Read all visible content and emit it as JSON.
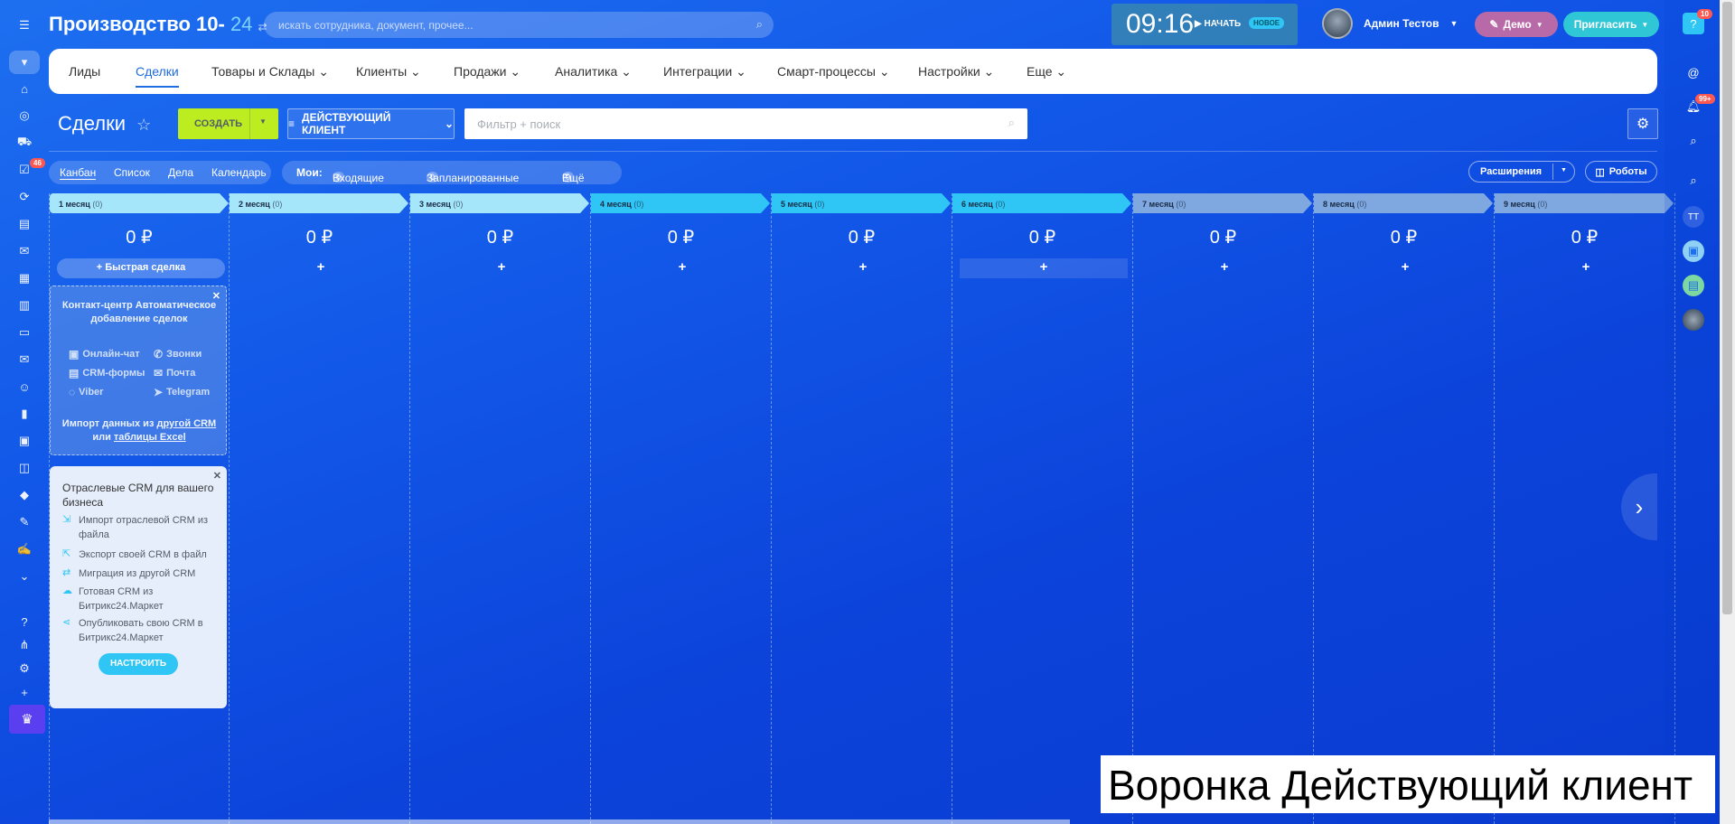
{
  "header": {
    "portal_name": "Производство 10-",
    "portal_suffix": "24",
    "search_placeholder": "искать сотрудника, документ, прочее...",
    "time": "09:16",
    "start_label": "НАЧАТЬ",
    "new_badge": "НОВОЕ",
    "user_name": "Админ Тестов",
    "demo_label": "Демо",
    "invite_label": "Пригласить",
    "help_badge": "10"
  },
  "nav": {
    "items": [
      {
        "label": "Лиды"
      },
      {
        "label": "Сделки",
        "active": true
      },
      {
        "label": "Товары и Склады",
        "dropdown": true
      },
      {
        "label": "Клиенты",
        "dropdown": true
      },
      {
        "label": "Продажи",
        "dropdown": true
      },
      {
        "label": "Аналитика",
        "dropdown": true
      },
      {
        "label": "Интеграции",
        "dropdown": true
      },
      {
        "label": "Смарт-процессы",
        "dropdown": true
      },
      {
        "label": "Настройки",
        "dropdown": true
      },
      {
        "label": "Еще",
        "dropdown": true
      }
    ]
  },
  "page": {
    "title": "Сделки",
    "create_label": "СОЗДАТЬ",
    "pipeline_label": "ДЕЙСТВУЮЩИЙ КЛИЕНТ",
    "filter_placeholder": "Фильтр + поиск"
  },
  "views": {
    "items": [
      "Канбан",
      "Список",
      "Дела",
      "Календарь"
    ],
    "active": "Канбан"
  },
  "moi": {
    "label": "Мои:",
    "incoming_count": "0",
    "incoming_label": "Входящие",
    "planned_count": "0",
    "planned_label": "Запланированные",
    "more_count": "0",
    "more_label": "Ещё"
  },
  "toolbar_right": {
    "extensions_label": "Расширения",
    "robots_label": "Роботы"
  },
  "stages": [
    {
      "name": "1 месяц",
      "count": "(0)",
      "sum": "0 ₽",
      "color": "#a6e6fb"
    },
    {
      "name": "2 месяц",
      "count": "(0)",
      "sum": "0 ₽",
      "color": "#a6e6fb"
    },
    {
      "name": "3 месяц",
      "count": "(0)",
      "sum": "0 ₽",
      "color": "#a6e6fb"
    },
    {
      "name": "4 месяц",
      "count": "(0)",
      "sum": "0 ₽",
      "color": "#2fc6f6"
    },
    {
      "name": "5 месяц",
      "count": "(0)",
      "sum": "0 ₽",
      "color": "#2fc6f6"
    },
    {
      "name": "6 месяц",
      "count": "(0)",
      "sum": "0 ₽",
      "color": "#2fc6f6"
    },
    {
      "name": "7 месяц",
      "count": "(0)",
      "sum": "0 ₽",
      "color": "#7fa7e0"
    },
    {
      "name": "8 месяц",
      "count": "(0)",
      "sum": "0 ₽",
      "color": "#7fa7e0"
    },
    {
      "name": "9 месяц",
      "count": "(0)",
      "sum": "0 ₽",
      "color": "#7fa7e0"
    }
  ],
  "quick_deal_label": "Быстрая сделка",
  "contact_center": {
    "title": "Контакт-центр Автоматическое добавление сделок",
    "channels": [
      "Онлайн-чат",
      "Звонки",
      "CRM-формы",
      "Почта",
      "Viber",
      "Telegram"
    ],
    "import_prefix": "Импорт данных из",
    "import_link1": "другой CRM",
    "import_or": "или",
    "import_link2": "таблицы Excel"
  },
  "industry_card": {
    "title": "Отраслевые CRM для вашего бизнеса",
    "items": [
      "Импорт отраслевой CRM из файла",
      "Экспорт своей CRM в файл",
      "Миграция из другой CRM",
      "Готовая CRM из Битрикс24.Маркет",
      "Опубликовать свою CRM в Битрикс24.Маркет"
    ],
    "setup_label": "НАСТРОИТЬ"
  },
  "rail": {
    "tasks_badge": "46"
  },
  "right_panel": {
    "notif_badge": "99+",
    "user_initials": "ТТ"
  },
  "caption": "Воронка Действующий клиент"
}
